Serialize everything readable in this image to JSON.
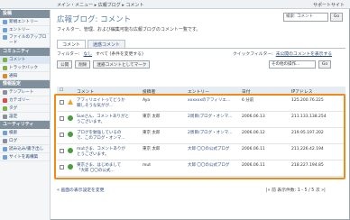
{
  "header": {
    "breadcrumb": "メイン・メニュー ▸ 広報ブログ ▸ コメント",
    "help_site": "サポートサイト"
  },
  "sidebar": {
    "sections": [
      {
        "title": "投稿",
        "items": [
          {
            "label": "新規エントリー",
            "icon_color": "#6fa1d6"
          },
          {
            "label": "エントリー",
            "icon_color": "#6fa1d6"
          },
          {
            "label": "ファイルのアップロード",
            "icon_color": "#6fa1d6",
            "tall": true
          }
        ]
      },
      {
        "title": "コミュニティ",
        "items": [
          {
            "label": "コメント",
            "icon_color": "#7fb24a",
            "active": true
          },
          {
            "label": "トラックバック",
            "icon_color": "#7fb24a"
          },
          {
            "label": "通知",
            "icon_color": "#d88b2a"
          }
        ]
      },
      {
        "title": "情報設定",
        "items": [
          {
            "label": "テンプレート",
            "icon_color": "#8a8fa0"
          },
          {
            "label": "カテゴリー",
            "icon_color": "#e04a4a"
          },
          {
            "label": "タグ",
            "icon_color": "#7fb24a"
          },
          {
            "label": "設定",
            "icon_color": "#8a8fa0"
          }
        ]
      },
      {
        "title": "ユーティリティ",
        "items": [
          {
            "label": "検索",
            "icon_color": "#6fa1d6"
          },
          {
            "label": "ログ",
            "icon_color": "#8a8fa0"
          },
          {
            "label": "読み込み/書き出し",
            "icon_color": "#6fa1d6"
          },
          {
            "label": "サイトを再構築",
            "icon_color": "#6fa1d6"
          }
        ]
      }
    ]
  },
  "main": {
    "title": "広報ブログ: コメント",
    "description": "フィルター、管理、および編集可能な広報ブログのコメント一覧です。",
    "search_value": "検索: コメント",
    "search_button": "Go",
    "tabs": [
      "コメント",
      "迷惑コメント"
    ],
    "filter_label": "フィルター:",
    "filter_link": "なし",
    "filter_change": "すべて (条件を変更する)",
    "quick_filter_label": "クイックフィルター:",
    "quick_filter_links": [
      "未公開のコメントを表示する"
    ],
    "actions": [
      "公開",
      "削除",
      "迷惑コメントとしてマーク"
    ],
    "more_actions": "その他の操作...",
    "go_label": "Go"
  },
  "table": {
    "headers": [
      "コメント",
      "投稿者",
      "エントリー",
      "日付",
      "IPアドレス"
    ],
    "rows": [
      {
        "status": "warn",
        "comment": "アフィリエイトってどうか職しそうな気がが...",
        "author": "Aya",
        "entry": "xxxxxxのアフィリエ...",
        "date": "6 分前",
        "ip": "125.200.76.225"
      },
      {
        "status": "ok",
        "comment": "Sueさん、コメントありがとうございます。",
        "author": "東京 太郎",
        "entry": "2周目(ブログ・オンマ...",
        "date": "2006.06.13",
        "ip": "211.133.138.254"
      },
      {
        "status": "ok",
        "comment": "ブログを勉強しているので、このブログ・オンマ...",
        "author": "東京 太郎",
        "entry": "2周目(ブログ・オンマ...",
        "date": "2006.06.12",
        "ip": "219.95.197.202"
      },
      {
        "status": "ok",
        "comment": "mutさま、コメントありがとうございます。",
        "author": "東京 太郎",
        "entry": "大郎 〇〇の公式ブログ",
        "date": "2006.06.11",
        "ip": "211.226.42.194"
      },
      {
        "status": "ok",
        "comment": "東京さま、はじめまして「大郎 〇〇の公式...",
        "author": "mut",
        "entry": "大郎 〇〇の公式ブログ",
        "date": "2006.06.11",
        "ip": "218.227.194.85"
      }
    ]
  },
  "pager": {
    "back": "« 画面の表示設定を変更",
    "pages": "|« 前  表示件数: 1 - 5 / 5  次 »|"
  },
  "colors": {
    "highlight": "#f28a1a",
    "accent": "#5a7fa6"
  }
}
